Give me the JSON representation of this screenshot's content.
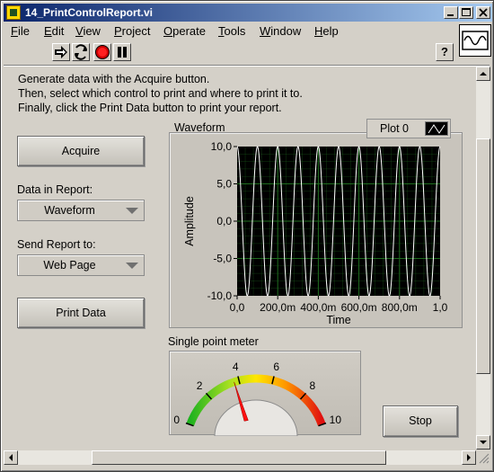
{
  "window": {
    "title": "14_PrintControlReport.vi"
  },
  "menu": [
    {
      "label": "File",
      "u": "F",
      "rest": "ile"
    },
    {
      "label": "Edit",
      "u": "E",
      "rest": "dit"
    },
    {
      "label": "View",
      "u": "V",
      "rest": "iew"
    },
    {
      "label": "Project",
      "u": "P",
      "rest": "roject"
    },
    {
      "label": "Operate",
      "u": "O",
      "rest": "perate"
    },
    {
      "label": "Tools",
      "u": "T",
      "rest": "ools"
    },
    {
      "label": "Window",
      "u": "W",
      "rest": "indow"
    },
    {
      "label": "Help",
      "u": "H",
      "rest": "elp"
    }
  ],
  "toolbar": {
    "help_label": "?"
  },
  "instructions": [
    "Generate data with the Acquire button.",
    "Then, select which control to print and where to print it to.",
    "Finally, click the Print Data button to print your report."
  ],
  "controls": {
    "acquire_label": "Acquire",
    "data_in_report_label": "Data in Report:",
    "data_in_report_value": "Waveform",
    "send_report_label": "Send Report to:",
    "send_report_value": "Web Page",
    "print_label": "Print Data",
    "stop_label": "Stop"
  },
  "graph": {
    "title": "Waveform",
    "legend": "Plot 0",
    "colors": {
      "plot_bg": "#000000",
      "grid": "#1f6b1f",
      "trace": "#ffffff"
    }
  },
  "chart_data": {
    "type": "line",
    "title": "Waveform",
    "xlabel": "Time",
    "ylabel": "Amplitude",
    "xlim": [
      0,
      1
    ],
    "ylim": [
      -10,
      10
    ],
    "x_ticks": [
      "0,0",
      "200,0m",
      "400,0m",
      "600,0m",
      "800,0m",
      "1,0"
    ],
    "y_ticks": [
      "10,0",
      "5,0",
      "0,0",
      "-5,0",
      "-10,0"
    ],
    "grid": true,
    "series": [
      {
        "name": "Plot 0",
        "function": "sine",
        "amplitude": 10,
        "cycles": 10,
        "phase_deg": 90
      }
    ]
  },
  "meter": {
    "label": "Single point meter",
    "scale": [
      "0",
      "2",
      "4",
      "6",
      "8",
      "10"
    ],
    "min": 0,
    "max": 10,
    "value": 3.7
  }
}
